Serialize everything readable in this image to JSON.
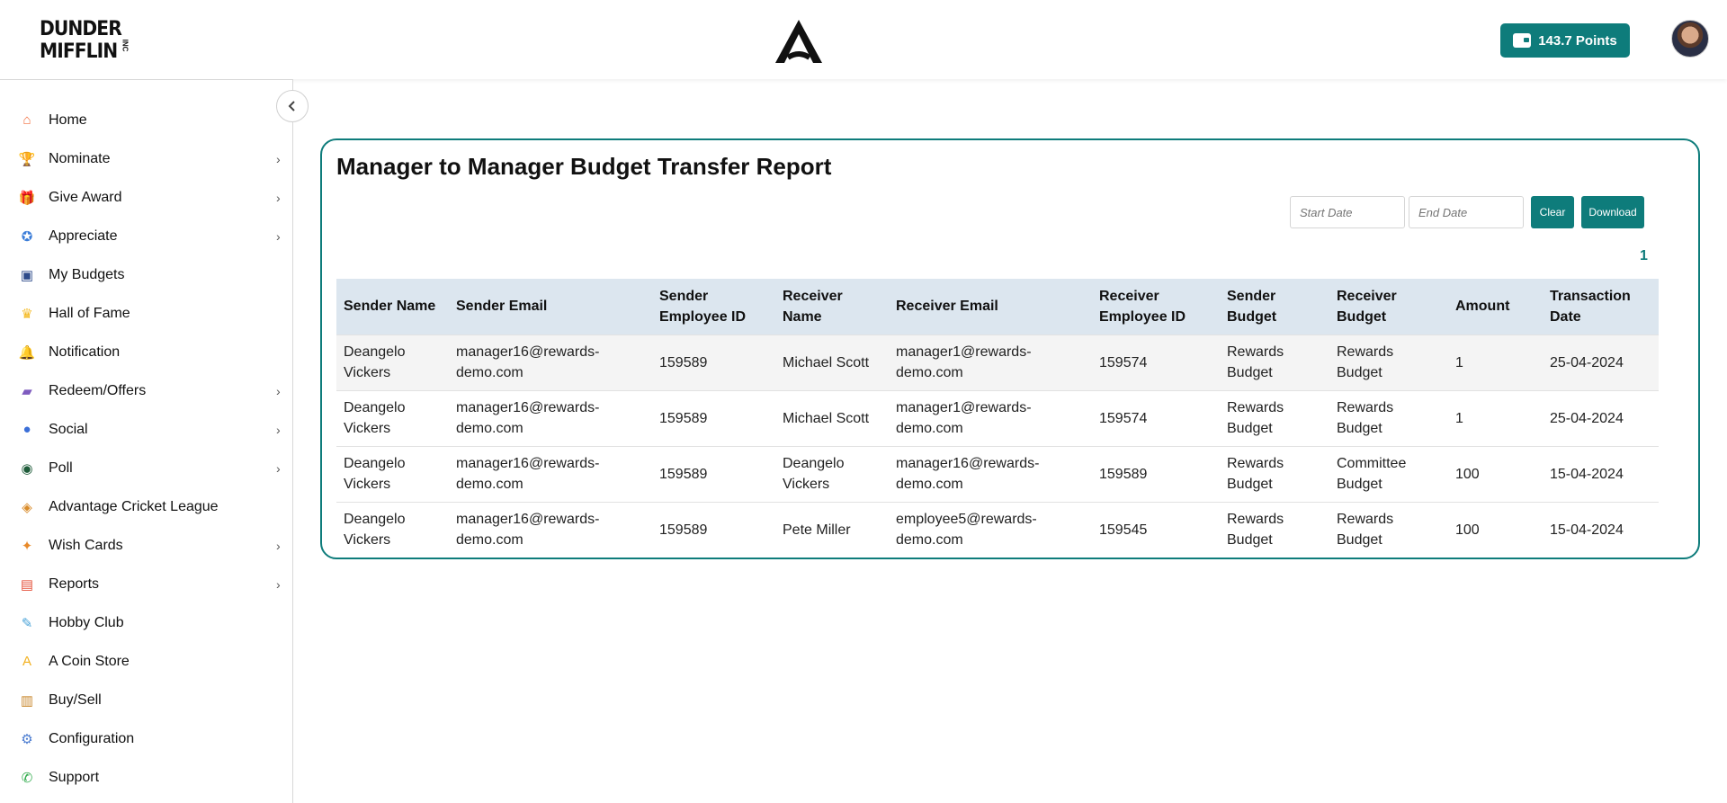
{
  "header": {
    "brand_line1": "DUNDER",
    "brand_line2": "MIFFLIN",
    "brand_inc": "INC",
    "points_label": "143.7  Points"
  },
  "sidebar": {
    "items": [
      {
        "label": "Home",
        "icon": "home-icon",
        "has_children": false
      },
      {
        "label": "Nominate",
        "icon": "trophy-icon",
        "has_children": true
      },
      {
        "label": "Give Award",
        "icon": "gift-icon",
        "has_children": true
      },
      {
        "label": "Appreciate",
        "icon": "badge-icon",
        "has_children": true
      },
      {
        "label": "My Budgets",
        "icon": "budget-icon",
        "has_children": false
      },
      {
        "label": "Hall of Fame",
        "icon": "crown-icon",
        "has_children": false
      },
      {
        "label": "Notification",
        "icon": "bell-icon",
        "has_children": false
      },
      {
        "label": "Redeem/Offers",
        "icon": "wallet-icon",
        "has_children": true
      },
      {
        "label": "Social",
        "icon": "social-icon",
        "has_children": true
      },
      {
        "label": "Poll",
        "icon": "poll-icon",
        "has_children": true
      },
      {
        "label": "Advantage Cricket League",
        "icon": "cricket-icon",
        "has_children": false
      },
      {
        "label": "Wish Cards",
        "icon": "party-icon",
        "has_children": true
      },
      {
        "label": "Reports",
        "icon": "clipboard-icon",
        "has_children": true
      },
      {
        "label": "Hobby Club",
        "icon": "hobby-icon",
        "has_children": false
      },
      {
        "label": "A Coin Store",
        "icon": "coin-icon",
        "has_children": false
      },
      {
        "label": "Buy/Sell",
        "icon": "shopping-bag-icon",
        "has_children": false
      },
      {
        "label": "Configuration",
        "icon": "config-icon",
        "has_children": false
      },
      {
        "label": "Support",
        "icon": "phone-icon",
        "has_children": false
      }
    ]
  },
  "report": {
    "title": "Manager to Manager Budget Transfer Report",
    "start_date_placeholder": "Start Date",
    "end_date_placeholder": "End Date",
    "clear_label": "Clear",
    "download_label": "Download",
    "page_number": "1",
    "columns": [
      "Sender Name",
      "Sender Email",
      "Sender Employee ID",
      "Receiver Name",
      "Receiver Email",
      "Receiver Employee ID",
      "Sender Budget",
      "Receiver Budget",
      "Amount",
      "Transaction Date"
    ],
    "rows": [
      [
        "Deangelo Vickers",
        "manager16@rewards-demo.com",
        "159589",
        "Michael Scott",
        "manager1@rewards-demo.com",
        "159574",
        "Rewards Budget",
        "Rewards Budget",
        "1",
        "25-04-2024"
      ],
      [
        "Deangelo Vickers",
        "manager16@rewards-demo.com",
        "159589",
        "Michael Scott",
        "manager1@rewards-demo.com",
        "159574",
        "Rewards Budget",
        "Rewards Budget",
        "1",
        "25-04-2024"
      ],
      [
        "Deangelo Vickers",
        "manager16@rewards-demo.com",
        "159589",
        "Deangelo Vickers",
        "manager16@rewards-demo.com",
        "159589",
        "Rewards Budget",
        "Committee Budget",
        "100",
        "15-04-2024"
      ],
      [
        "Deangelo Vickers",
        "manager16@rewards-demo.com",
        "159589",
        "Pete Miller",
        "employee5@rewards-demo.com",
        "159545",
        "Rewards Budget",
        "Rewards Budget",
        "100",
        "15-04-2024"
      ]
    ]
  },
  "colors": {
    "accent": "#0e7c7b",
    "table_header_bg": "#dce6ef"
  }
}
